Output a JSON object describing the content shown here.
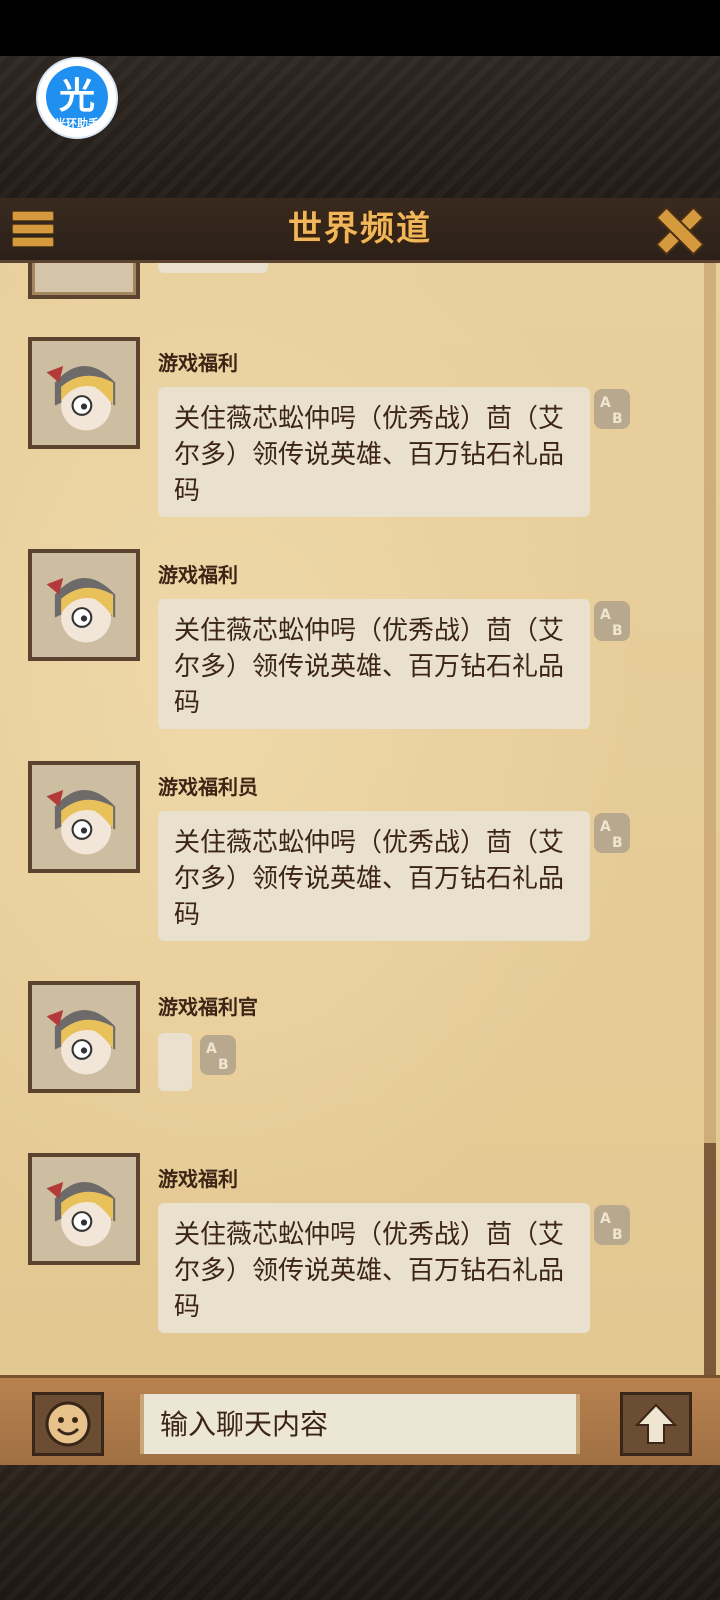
{
  "badge": {
    "glyph": "光",
    "label": "光环助手"
  },
  "header": {
    "title": "世界频道"
  },
  "messages": [
    {
      "username": "游戏福利",
      "text": "关住薇芯蚣仲呺（优秀战）茴（艾尔多）领传说英雄、百万钻石礼品码"
    },
    {
      "username": "游戏福利",
      "text": "关住薇芯蚣仲呺（优秀战）茴（艾尔多）领传说英雄、百万钻石礼品码"
    },
    {
      "username": "游戏福利员",
      "text": "关住薇芯蚣仲呺（优秀战）茴（艾尔多）领传说英雄、百万钻石礼品码"
    },
    {
      "username": "游戏福利官",
      "text": ""
    },
    {
      "username": "游戏福利",
      "text": "关住薇芯蚣仲呺（优秀战）茴（艾尔多）领传说英雄、百万钻石礼品码"
    }
  ],
  "input": {
    "placeholder": "输入聊天内容"
  },
  "icons": {
    "menu": "menu-icon",
    "close": "close-icon",
    "translate": "translate-icon",
    "emoji": "smiley-icon",
    "send": "arrow-up-icon"
  }
}
